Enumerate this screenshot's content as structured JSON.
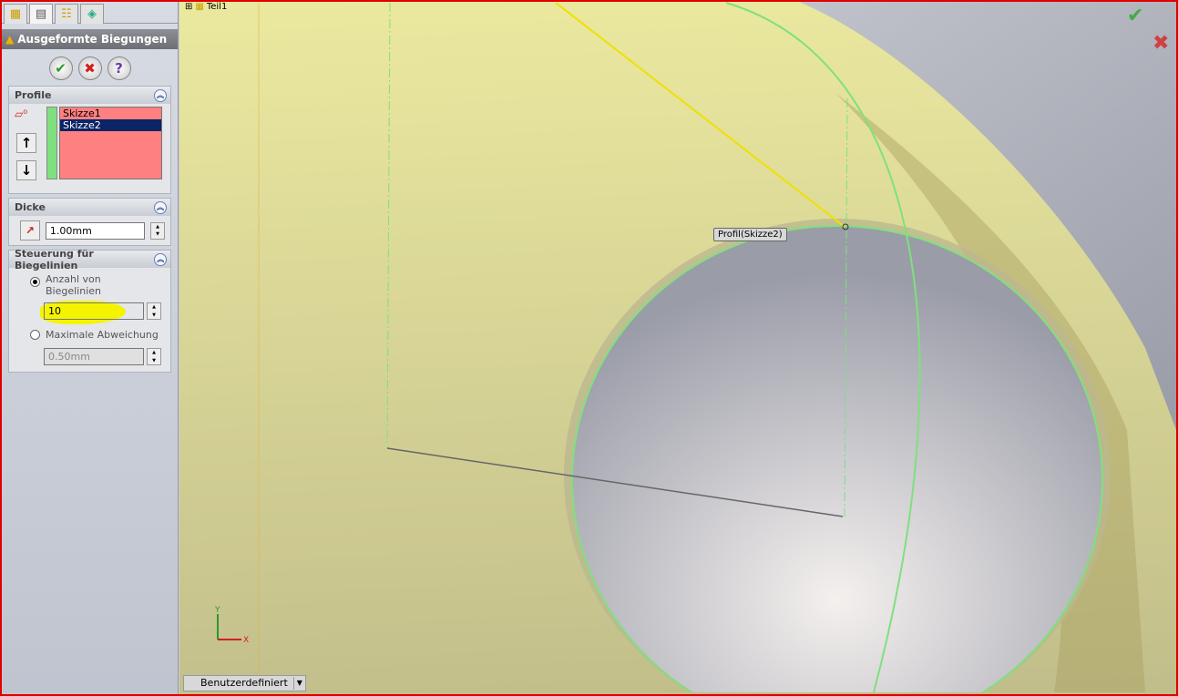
{
  "panel": {
    "title": "Ausgeformte Biegungen",
    "ok": "✔",
    "cancel": "✖",
    "help": "?",
    "profile": {
      "header": "Profile",
      "items": [
        "Skizze1",
        "Skizze2"
      ],
      "selected": 1
    },
    "dicke": {
      "header": "Dicke",
      "value": "1.00mm"
    },
    "steuerung": {
      "header": "Steuerung für Biegelinien",
      "option1": "Anzahl von Biegelinien",
      "option1_line1": "Anzahl von",
      "option1_line2": "Biegelinien",
      "count": "10",
      "option2": "Maximale Abweichung",
      "deviation": "0.50mm",
      "selected_option": "option1"
    }
  },
  "viewport": {
    "tree_item": "Teil1",
    "callout": "Profil(Skizze2)",
    "view_mode": "Benutzerdefiniert",
    "axis_x": "X",
    "axis_y": "Y"
  },
  "colors": {
    "surface": "#e8e490",
    "accent_green": "#7fe07f",
    "highlight": "#f4f400"
  }
}
